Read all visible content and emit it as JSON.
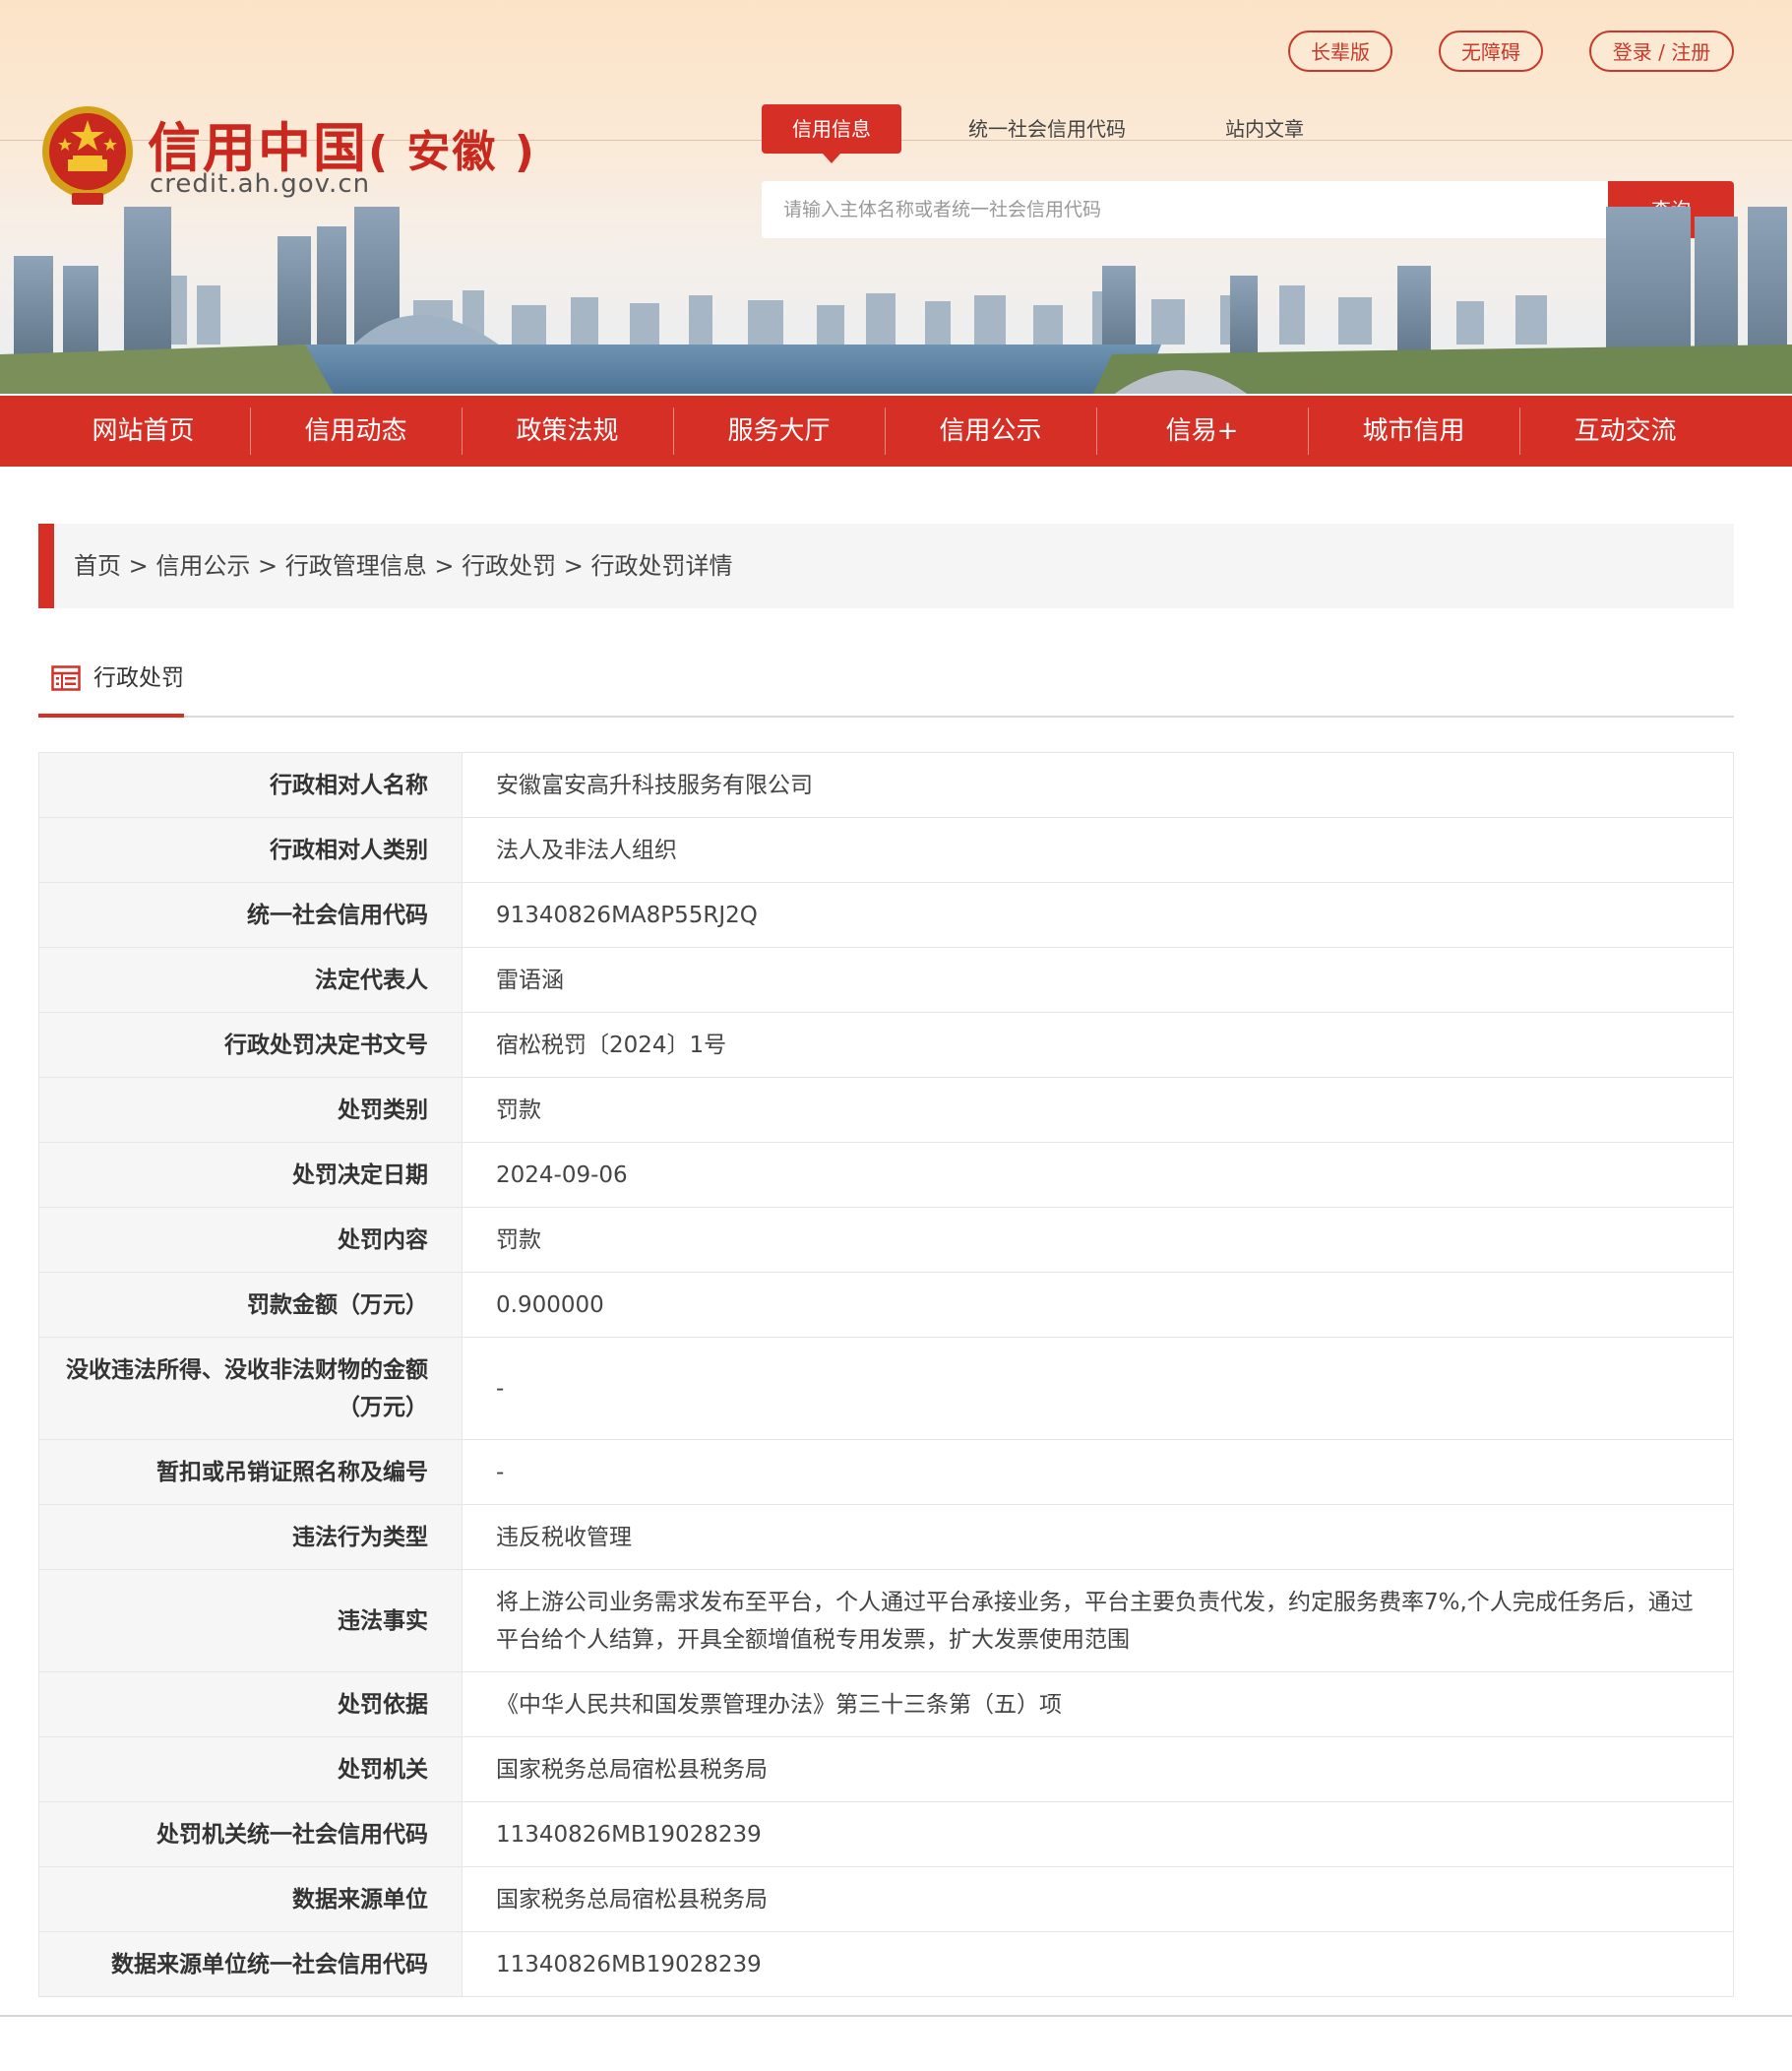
{
  "header": {
    "top_buttons": [
      "长辈版",
      "无障碍",
      "登录 / 注册"
    ],
    "site_title": "信用中国",
    "site_title_suffix": "( 安徽 )",
    "site_url": "credit.ah.gov.cn",
    "search_tabs": [
      "信用信息",
      "统一社会信用代码",
      "站内文章"
    ],
    "search_placeholder": "请输入主体名称或者统一社会信用代码",
    "search_button": "查询"
  },
  "nav": [
    "网站首页",
    "信用动态",
    "政策法规",
    "服务大厅",
    "信用公示",
    "信易+",
    "城市信用",
    "互动交流"
  ],
  "breadcrumb": "首页 > 信用公示 >  行政管理信息 >  行政处罚 > 行政处罚详情",
  "section_title": "行政处罚",
  "details": [
    {
      "label": "行政相对人名称",
      "value": "安徽富安高升科技服务有限公司"
    },
    {
      "label": "行政相对人类别",
      "value": "法人及非法人组织"
    },
    {
      "label": "统一社会信用代码",
      "value": "91340826MA8P55RJ2Q"
    },
    {
      "label": "法定代表人",
      "value": "雷语涵"
    },
    {
      "label": "行政处罚决定书文号",
      "value": "宿松税罚〔2024〕1号"
    },
    {
      "label": "处罚类别",
      "value": "罚款"
    },
    {
      "label": "处罚决定日期",
      "value": "2024-09-06"
    },
    {
      "label": "处罚内容",
      "value": "罚款"
    },
    {
      "label": "罚款金额（万元）",
      "value": "0.900000"
    },
    {
      "label": "没收违法所得、没收非法财物的金额（万元）",
      "value": "-"
    },
    {
      "label": "暂扣或吊销证照名称及编号",
      "value": "-"
    },
    {
      "label": "违法行为类型",
      "value": "违反税收管理"
    },
    {
      "label": "违法事实",
      "value": "将上游公司业务需求发布至平台，个人通过平台承接业务，平台主要负责代发，约定服务费率7%,个人完成任务后，通过平台给个人结算，开具全额增值税专用发票，扩大发票使用范围"
    },
    {
      "label": "处罚依据",
      "value": "《中华人民共和国发票管理办法》第三十三条第（五）项"
    },
    {
      "label": "处罚机关",
      "value": "国家税务总局宿松县税务局"
    },
    {
      "label": "处罚机关统一社会信用代码",
      "value": "11340826MB19028239"
    },
    {
      "label": "数据来源单位",
      "value": "国家税务总局宿松县税务局"
    },
    {
      "label": "数据来源单位统一社会信用代码",
      "value": "11340826MB19028239"
    }
  ]
}
